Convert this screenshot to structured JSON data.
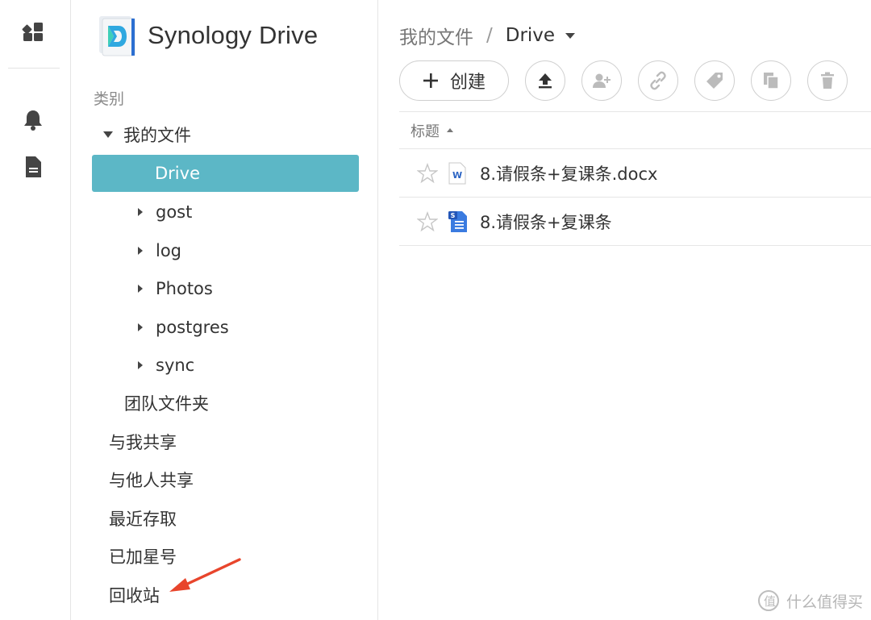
{
  "app": {
    "name": "Synology Drive"
  },
  "sidebar": {
    "category_label": "类别",
    "my_files": "我的文件",
    "folders": [
      {
        "label": "Drive",
        "selected": true
      },
      {
        "label": "gost"
      },
      {
        "label": "log"
      },
      {
        "label": "Photos"
      },
      {
        "label": "postgres"
      },
      {
        "label": "sync"
      }
    ],
    "team_folder": "团队文件夹",
    "shared_with_me": "与我共享",
    "shared_with_others": "与他人共享",
    "recent": "最近存取",
    "starred": "已加星号",
    "recycle_bin": "回收站"
  },
  "breadcrumb": {
    "root": "我的文件",
    "separator": "/",
    "current": "Drive"
  },
  "toolbar": {
    "create_label": "创建"
  },
  "list": {
    "column_title": "标题",
    "files": [
      {
        "name": "8.请假条+复课条.docx",
        "type": "word"
      },
      {
        "name": "8.请假条+复课条",
        "type": "synology-doc"
      }
    ]
  },
  "watermark": {
    "text": "什么值得买"
  },
  "colors": {
    "selected_bg": "#5cb7c6",
    "annotation_arrow": "#e8452c"
  },
  "icons": {
    "rail": [
      "dashboard-icon",
      "bell-icon",
      "document-icon"
    ],
    "toolbar": [
      "upload-icon",
      "add-user-icon",
      "link-icon",
      "tag-icon",
      "copy-icon",
      "trash-icon"
    ]
  }
}
